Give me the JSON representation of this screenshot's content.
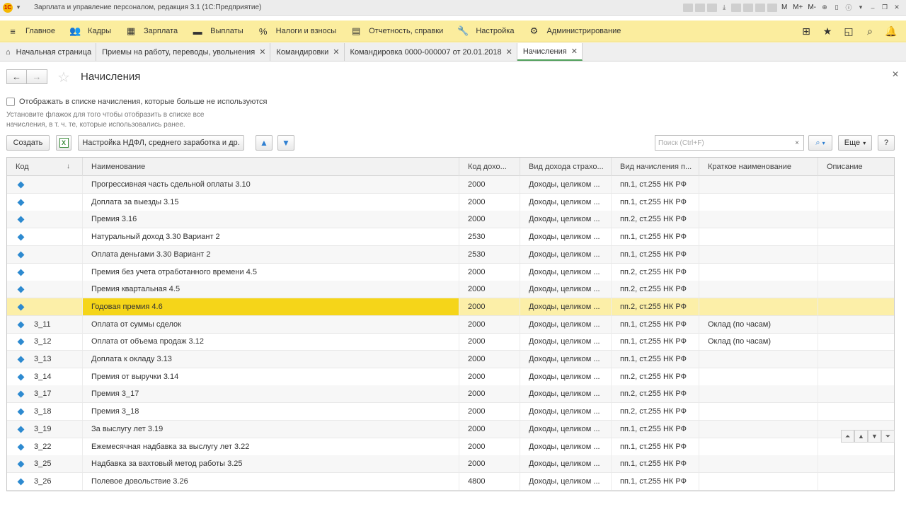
{
  "window": {
    "title": "Зарплата и управление персоналом, редакция 3.1  (1С:Предприятие)",
    "tools_text": [
      "M",
      "M+",
      "M-"
    ]
  },
  "menu": {
    "items": [
      {
        "label": "Главное",
        "icon": "hamburger-icon"
      },
      {
        "label": "Кадры",
        "icon": "people-icon"
      },
      {
        "label": "Зарплата",
        "icon": "calculator-icon"
      },
      {
        "label": "Выплаты",
        "icon": "wallet-icon"
      },
      {
        "label": "Налоги и взносы",
        "icon": "percent-icon"
      },
      {
        "label": "Отчетность, справки",
        "icon": "report-icon"
      },
      {
        "label": "Настройка",
        "icon": "wrench-icon"
      },
      {
        "label": "Администрирование",
        "icon": "gear-icon"
      }
    ]
  },
  "tabs": [
    {
      "label": "Начальная страница",
      "closable": false
    },
    {
      "label": "Приемы на работу, переводы, увольнения",
      "closable": true
    },
    {
      "label": "Командировки",
      "closable": true
    },
    {
      "label": "Командировка 0000-000007 от 20.01.2018",
      "closable": true
    },
    {
      "label": "Начисления",
      "closable": true,
      "active": true
    }
  ],
  "form": {
    "title": "Начисления",
    "show_unused_label": "Отображать в списке начисления, которые больше не используются",
    "show_unused_hint": "Установите флажок для того чтобы отобразить в списке все начисления, в т. ч. те, которые использовались ранее.",
    "create_label": "Создать",
    "ndfl_settings_label": "Настройка НДФЛ, среднего заработка и др.",
    "search_placeholder": "Поиск (Ctrl+F)",
    "clear_glyph": "×",
    "more_label": "Еще",
    "help_label": "?"
  },
  "table": {
    "columns": [
      "Код",
      "Наименование",
      "Код дохо...",
      "Вид дохода страхо...",
      "Вид начисления п...",
      "Краткое наименование",
      "Описание"
    ],
    "rows": [
      {
        "code": "",
        "name": "Прогрессивная часть сдельной оплаты 3.10",
        "income_code": "2000",
        "income_kind": "Доходы, целиком ...",
        "accrual_kind": "пп.1, ст.255 НК РФ",
        "short_name": "",
        "description": ""
      },
      {
        "code": "",
        "name": "Доплата за выезды 3.15",
        "income_code": "2000",
        "income_kind": "Доходы, целиком ...",
        "accrual_kind": "пп.1, ст.255 НК РФ",
        "short_name": "",
        "description": ""
      },
      {
        "code": "",
        "name": "Премия 3.16",
        "income_code": "2000",
        "income_kind": "Доходы, целиком ...",
        "accrual_kind": "пп.2, ст.255 НК РФ",
        "short_name": "",
        "description": ""
      },
      {
        "code": "",
        "name": "Натуральный доход 3.30 Вариант 2",
        "income_code": "2530",
        "income_kind": "Доходы, целиком ...",
        "accrual_kind": "пп.1, ст.255 НК РФ",
        "short_name": "",
        "description": ""
      },
      {
        "code": "",
        "name": "Оплата деньгами 3.30 Вариант 2",
        "income_code": "2530",
        "income_kind": "Доходы, целиком ...",
        "accrual_kind": "пп.1, ст.255 НК РФ",
        "short_name": "",
        "description": ""
      },
      {
        "code": "",
        "name": "Премия без учета отработанного времени 4.5",
        "income_code": "2000",
        "income_kind": "Доходы, целиком ...",
        "accrual_kind": "пп.2, ст.255 НК РФ",
        "short_name": "",
        "description": ""
      },
      {
        "code": "",
        "name": "Премия квартальная 4.5",
        "income_code": "2000",
        "income_kind": "Доходы, целиком ...",
        "accrual_kind": "пп.2, ст.255 НК РФ",
        "short_name": "",
        "description": ""
      },
      {
        "code": "",
        "name": "Годовая премия 4.6",
        "income_code": "2000",
        "income_kind": "Доходы, целиком ...",
        "accrual_kind": "пп.2, ст.255 НК РФ",
        "short_name": "",
        "description": "",
        "selected": true
      },
      {
        "code": "3_11",
        "name": "Оплата от суммы сделок",
        "income_code": "2000",
        "income_kind": "Доходы, целиком ...",
        "accrual_kind": "пп.1, ст.255 НК РФ",
        "short_name": "Оклад (по часам)",
        "description": ""
      },
      {
        "code": "3_12",
        "name": "Оплата от объема продаж 3.12",
        "income_code": "2000",
        "income_kind": "Доходы, целиком ...",
        "accrual_kind": "пп.1, ст.255 НК РФ",
        "short_name": "Оклад (по часам)",
        "description": ""
      },
      {
        "code": "3_13",
        "name": "Доплата к окладу 3.13",
        "income_code": "2000",
        "income_kind": "Доходы, целиком ...",
        "accrual_kind": "пп.1, ст.255 НК РФ",
        "short_name": "",
        "description": ""
      },
      {
        "code": "3_14",
        "name": "Премия от выручки 3.14",
        "income_code": "2000",
        "income_kind": "Доходы, целиком ...",
        "accrual_kind": "пп.2, ст.255 НК РФ",
        "short_name": "",
        "description": ""
      },
      {
        "code": "3_17",
        "name": "Премия 3_17",
        "income_code": "2000",
        "income_kind": "Доходы, целиком ...",
        "accrual_kind": "пп.2, ст.255 НК РФ",
        "short_name": "",
        "description": ""
      },
      {
        "code": "3_18",
        "name": "Премия 3_18",
        "income_code": "2000",
        "income_kind": "Доходы, целиком ...",
        "accrual_kind": "пп.2, ст.255 НК РФ",
        "short_name": "",
        "description": ""
      },
      {
        "code": "3_19",
        "name": "За выслугу лет 3.19",
        "income_code": "2000",
        "income_kind": "Доходы, целиком ...",
        "accrual_kind": "пп.1, ст.255 НК РФ",
        "short_name": "",
        "description": ""
      },
      {
        "code": "3_22",
        "name": "Ежемесячная надбавка за выслугу лет 3.22",
        "income_code": "2000",
        "income_kind": "Доходы, целиком ...",
        "accrual_kind": "пп.1, ст.255 НК РФ",
        "short_name": "",
        "description": ""
      },
      {
        "code": "3_25",
        "name": "Надбавка за вахтовый метод работы 3.25",
        "income_code": "2000",
        "income_kind": "Доходы, целиком ...",
        "accrual_kind": "пп.1, ст.255 НК РФ",
        "short_name": "",
        "description": ""
      },
      {
        "code": "3_26",
        "name": "Полевое довольствие 3.26",
        "income_code": "4800",
        "income_kind": "Доходы, целиком ...",
        "accrual_kind": "пп.1, ст.255 НК РФ",
        "short_name": "",
        "description": ""
      }
    ]
  },
  "colors": {
    "menubar": "#fbed9e",
    "selected_row": "#fcefa8",
    "selected_cell": "#f5d519",
    "active_tab_underline": "#4fa05a",
    "row_marker": "#2d8ad0"
  }
}
